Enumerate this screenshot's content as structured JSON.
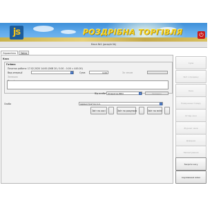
{
  "header": {
    "logo_text": "js",
    "brand_title": "РОЗДРІБНА ТОРГІВЛЯ",
    "power_icon": "power-icon"
  },
  "window": {
    "title": "Каса №1 (розділ №)"
  },
  "tabs": [
    {
      "label": "Управління",
      "active": true
    },
    {
      "label": "Зміна",
      "active": false
    }
  ],
  "main": {
    "section_label": "Каса",
    "group": {
      "title": "Готівка",
      "shift_info": "Початок роботи: 17.02.2020 14:00 (БКВ 20 / 0.00 - 0.00 = 445.00)",
      "operation_type_label": "Вид операції",
      "operation_type_value": "",
      "amount_label": "Сума",
      "amount_value": "0.00",
      "receipt_label": "За чеком",
      "receipt_value": "",
      "balance_label": "Залишок",
      "balance_value": "",
      "note_label": "Примітка",
      "note_value": "",
      "responsible_label": "Від особи",
      "responsible_value": "Оператор ББО",
      "check_label": "Залишок"
    },
    "person_label": "Особа",
    "person_value": "Адміністратор А.А.",
    "buttons": [
      "Звіт по касі",
      "Звіт по рахунках",
      "Звіт по зміні"
    ]
  },
  "sidebar": [
    {
      "label": "Сума",
      "enabled": false
    },
    {
      "label": "Звіт з продажу",
      "enabled": false
    },
    {
      "label": "Каса",
      "enabled": false
    },
    {
      "label": "Повернення товару",
      "enabled": false
    },
    {
      "label": "Огляд каси",
      "enabled": false
    },
    {
      "label": "Журнал чеків",
      "enabled": false
    },
    {
      "label": "Довідник",
      "enabled": false
    },
    {
      "label": "Налаштування",
      "enabled": false
    },
    {
      "label": "Закрити касу",
      "enabled": true
    },
    {
      "label": "Анулювання зміни",
      "enabled": true
    }
  ]
}
